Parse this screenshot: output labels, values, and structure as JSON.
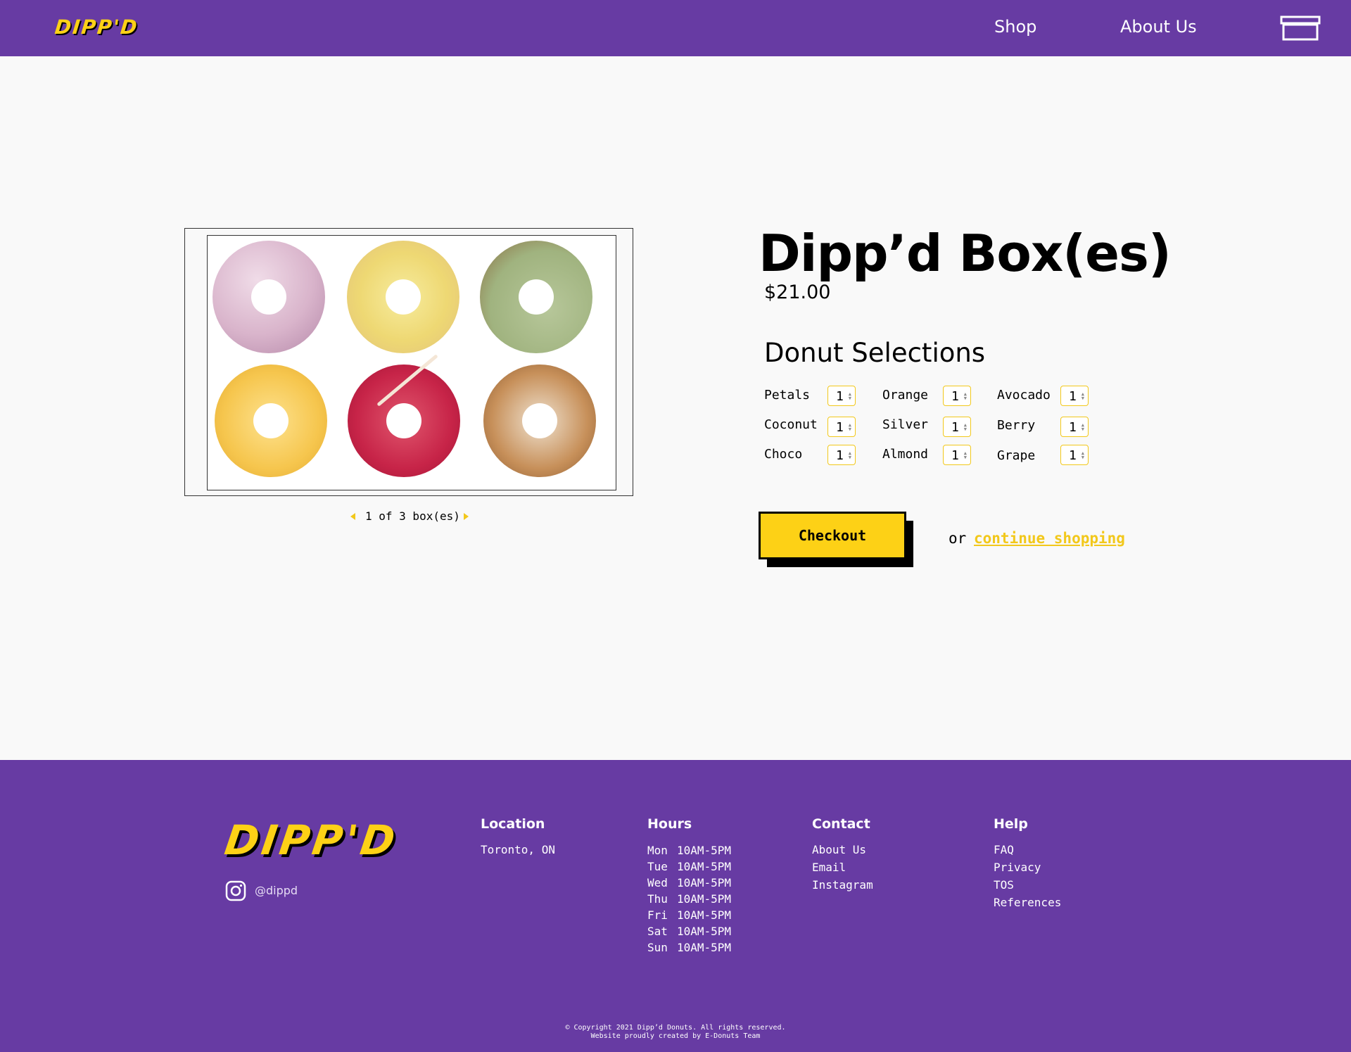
{
  "header": {
    "logo": "DIPP'D",
    "nav": {
      "shop": "Shop",
      "about": "About Us"
    },
    "cart_icon": "box-icon"
  },
  "colors": {
    "brand_purple": "#673ba3",
    "accent_yellow": "#fdd116",
    "background": "#f9f9f9"
  },
  "carousel": {
    "label": "1 of 3 box(es)",
    "donuts": [
      "petals-donut",
      "coconut-donut",
      "avocado-donut",
      "orange-donut",
      "berry-donut",
      "almond-donut"
    ]
  },
  "product": {
    "title": "Dipp’d Box(es)",
    "price": "$21.00",
    "selections_title": "Donut Selections",
    "flavors": [
      {
        "name": "Petals",
        "qty": "1"
      },
      {
        "name": "Orange",
        "qty": "1"
      },
      {
        "name": "Avocado",
        "qty": "1"
      },
      {
        "name": "Coconut",
        "qty": "1"
      },
      {
        "name": "Silver",
        "qty": "1"
      },
      {
        "name": "Berry",
        "qty": "1"
      },
      {
        "name": "Choco",
        "qty": "1"
      },
      {
        "name": "Almond",
        "qty": "1"
      },
      {
        "name": "Grape",
        "qty": "1"
      }
    ]
  },
  "checkout": {
    "button": "Checkout",
    "or": "or",
    "continue": "continue shopping"
  },
  "footer": {
    "logo": "DIPP'D",
    "instagram": "@dippd",
    "location": {
      "title": "Location",
      "value": "Toronto, ON"
    },
    "hours": {
      "title": "Hours",
      "rows": [
        {
          "day": "Mon",
          "time": "10AM-5PM"
        },
        {
          "day": "Tue",
          "time": "10AM-5PM"
        },
        {
          "day": "Wed",
          "time": "10AM-5PM"
        },
        {
          "day": "Thu",
          "time": "10AM-5PM"
        },
        {
          "day": "Fri",
          "time": "10AM-5PM"
        },
        {
          "day": "Sat",
          "time": "10AM-5PM"
        },
        {
          "day": "Sun",
          "time": "10AM-5PM"
        }
      ]
    },
    "contact": {
      "title": "Contact",
      "items": [
        "About Us",
        "Email",
        "Instagram"
      ]
    },
    "help": {
      "title": "Help",
      "items": [
        "FAQ",
        "Privacy",
        "TOS",
        "References"
      ]
    },
    "copyright": "© Copyright 2021 Dipp’d Donuts. All rights reserved.",
    "credit": "Website proudly created by E-Donuts Team"
  }
}
